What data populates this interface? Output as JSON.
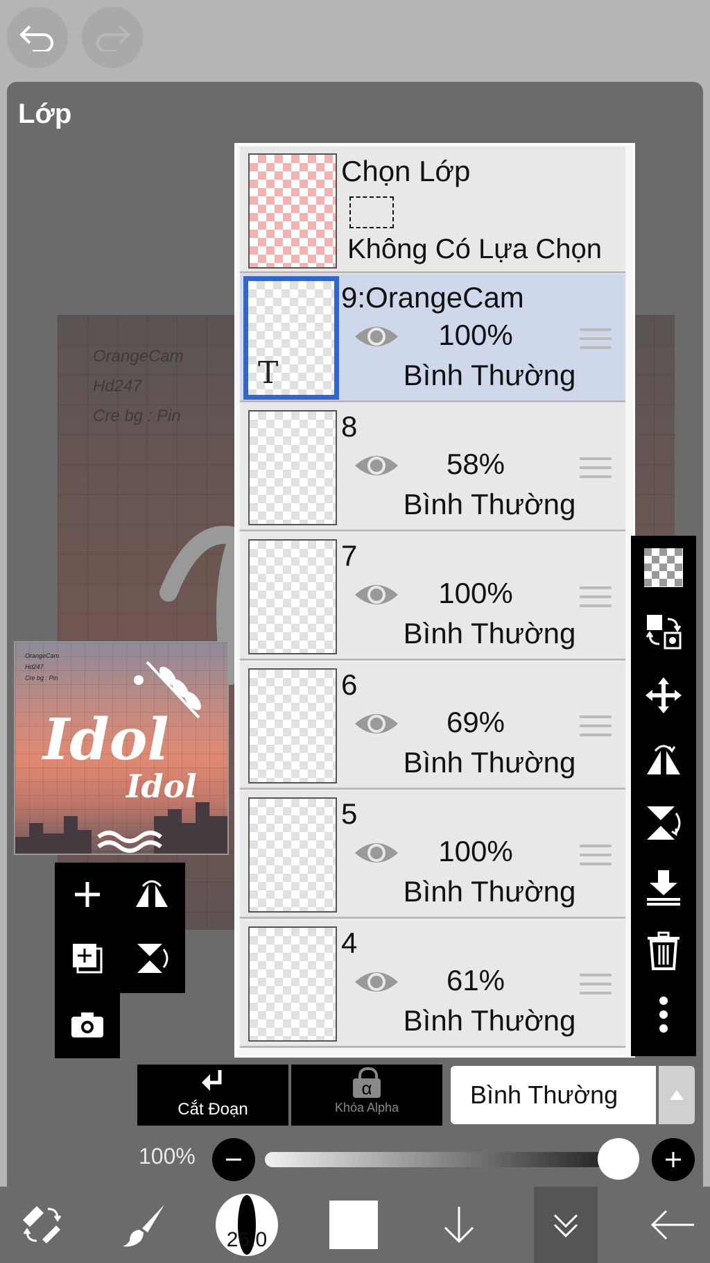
{
  "panel": {
    "title": "Lớp"
  },
  "canvas": {
    "lines": [
      "OrangeCam",
      "Hd247",
      "Cre bg : Pin"
    ]
  },
  "thumbnail": {
    "lines": [
      "OrangeCam",
      "Hd247",
      "Cre bg : Pin"
    ],
    "art_text": [
      "Idol",
      "Idol"
    ]
  },
  "selection_row": {
    "title": "Chọn Lớp",
    "status": "Không Có Lựa Chọn"
  },
  "layers": [
    {
      "name": "9:OrangeCam",
      "opacity": "100%",
      "mode": "Bình Thường",
      "selected": true,
      "thumb_glyph": "T"
    },
    {
      "name": "8",
      "opacity": "58%",
      "mode": "Bình Thường",
      "selected": false
    },
    {
      "name": "7",
      "opacity": "100%",
      "mode": "Bình Thường",
      "selected": false
    },
    {
      "name": "6",
      "opacity": "69%",
      "mode": "Bình Thường",
      "selected": false
    },
    {
      "name": "5",
      "opacity": "100%",
      "mode": "Bình Thường",
      "selected": false
    },
    {
      "name": "4",
      "opacity": "61%",
      "mode": "Bình Thường",
      "selected": false
    }
  ],
  "bottom": {
    "clip_label": "Cắt Đoạn",
    "alpha_lock_label": "Khóa Alpha",
    "alpha_glyph": "α",
    "blend_mode": "Bình Thường",
    "opacity_label": "100%",
    "opacity_value": 1.0
  },
  "toolbar": {
    "brush_size": "26.0"
  },
  "colors": {
    "selected_border": "#3366cc",
    "selected_row": "#cfd7ea",
    "panel": "#6b6b6b",
    "background": "#b5b5b5"
  }
}
